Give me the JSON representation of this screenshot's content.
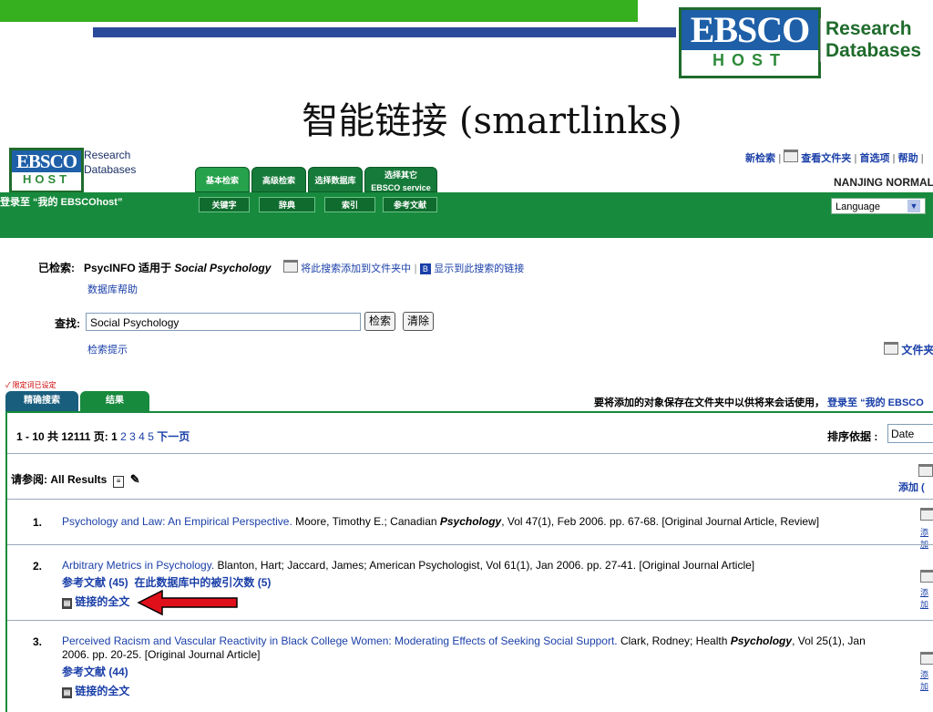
{
  "slide": {
    "title": "智能链接 (smartlinks)",
    "logo_ebsco": "EBSCO",
    "logo_host": "HOST",
    "logo_research": "Research",
    "logo_databases": "Databases"
  },
  "app": {
    "logo_ebsco": "EBSCO",
    "logo_host": "HOST",
    "logo_research": "Research",
    "logo_databases": "Databases",
    "tabs": [
      {
        "label": "基本检索"
      },
      {
        "label": "高级检索"
      },
      {
        "label": "选择数据库"
      },
      {
        "label": "选择其它",
        "label2": "EBSCO service"
      }
    ],
    "subtabs": [
      {
        "label": "关键字"
      },
      {
        "label": "辞典"
      },
      {
        "label": "索引"
      },
      {
        "label": "参考文献"
      }
    ],
    "login_link": "登录至 “我的 EBSCOhost”",
    "top_links": {
      "new_search": "新检索",
      "view_folder": "查看文件夹",
      "preferences": "首选项",
      "help": "帮助"
    },
    "institution": "NANJING NORMAL U",
    "language": "Language"
  },
  "search": {
    "searched_label": "已检索:",
    "searched_db": "PsycINFO 适用于",
    "searched_term": "Social Psychology",
    "add_to_folder": "将此搜索添加到文件夹中",
    "show_link": "显示到此搜索的链接",
    "db_help": "数据库帮助",
    "find_label": "查找:",
    "query": "Social Psychology",
    "search_button": "检索",
    "clear_button": "清除",
    "search_tips": "检索提示",
    "folder_link": "文件夹"
  },
  "results": {
    "limit_note": "✓ 限定词已设定",
    "tab_refine": "精确搜索",
    "tab_results": "结果",
    "save_note": "要将添加的对象保存在文件夹中以供将来会话使用，",
    "save_link": "登录至 “我的 EBSCO",
    "pager_text": "1 - 10 共 12111 页:",
    "pages": [
      "1",
      "2",
      "3",
      "4",
      "5"
    ],
    "next_page": "下一页",
    "sort_label": "排序依据 :",
    "sort_value": "Date",
    "see_also": "请参阅: All Results",
    "add_all": "添加 (",
    "items": [
      {
        "num": "1.",
        "title": "Psychology and Law: An Empirical Perspective.",
        "rest_a": " Moore, Timothy E.; Canadian ",
        "journal_bold": "Psychology",
        "rest_b": ", Vol 47(1), Feb 2006. pp. 67-68. [Original Journal Article, Review]",
        "add": "添加"
      },
      {
        "num": "2.",
        "title": "Arbitrary Metrics in Psychology.",
        "rest_a": " Blanton, Hart; Jaccard, James; American Psychologist, Vol 61(1), Jan 2006. pp. 27-41. [Original Journal Article]",
        "references": "参考文献 (45)",
        "cited": "在此数据库中的被引次数 (5)",
        "fulltext": "链接的全文",
        "add": "添加"
      },
      {
        "num": "3.",
        "title": "Perceived Racism and Vascular Reactivity in Black College Women: Moderating Effects of Seeking Social Support.",
        "rest_a": " Clark, Rodney; Health ",
        "journal_bold": "Psychology",
        "rest_b": ", Vol 25(1), Jan 2006. pp. 20-25. [Original Journal Article]",
        "references": "参考文献 (44)",
        "fulltext": "链接的全文",
        "add": "添加"
      }
    ]
  }
}
